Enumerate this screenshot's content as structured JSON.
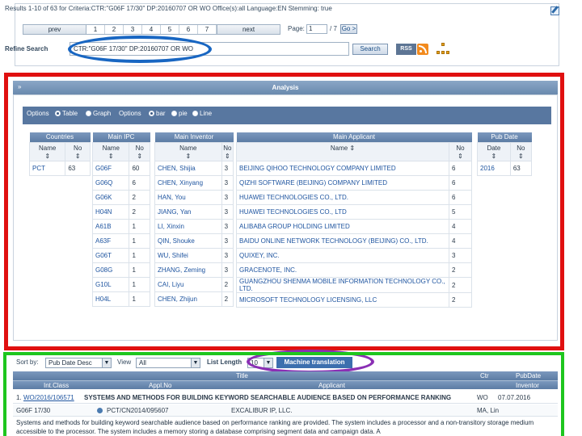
{
  "query": {
    "results_text": "Results 1-10 of 63 for Criteria:CTR:\"G06F 17/30\" DP:20160707 OR WO Office(s):all Language:EN Stemming: true",
    "pager": {
      "prev_label": "prev",
      "pages": [
        "1",
        "2",
        "3",
        "4",
        "5",
        "6",
        "7"
      ],
      "next_label": "next",
      "page_label": "Page:",
      "page_value": "1",
      "page_total": "/ 7",
      "go_label": "Go >"
    },
    "refine_label": "Refine Search",
    "refine_value": "CTR:\"G06F 17/30\" DP:20160707 OR WO",
    "search_label": "Search",
    "rss_label": "RSS"
  },
  "analysis": {
    "title": "Analysis",
    "options1_label": "Options",
    "table_label": "Table",
    "graph_label": "Graph",
    "options2_label": "Options",
    "bar_label": "bar",
    "pie_label": "pie",
    "line_label": "Line",
    "countries": {
      "header": "Countries",
      "col_name": "Name",
      "col_no": "No",
      "rows": [
        {
          "name": "PCT",
          "no": "63"
        }
      ]
    },
    "ipc": {
      "header": "Main IPC",
      "col_name": "Name",
      "col_no": "No",
      "rows": [
        {
          "name": "G06F",
          "no": "60"
        },
        {
          "name": "G06Q",
          "no": "6"
        },
        {
          "name": "G06K",
          "no": "2"
        },
        {
          "name": "H04N",
          "no": "2"
        },
        {
          "name": "A61B",
          "no": "1"
        },
        {
          "name": "A63F",
          "no": "1"
        },
        {
          "name": "G06T",
          "no": "1"
        },
        {
          "name": "G08G",
          "no": "1"
        },
        {
          "name": "G10L",
          "no": "1"
        },
        {
          "name": "H04L",
          "no": "1"
        }
      ]
    },
    "inventor": {
      "header": "Main Inventor",
      "col_name": "Name",
      "col_no": "No",
      "rows": [
        {
          "name": "CHEN, Shijia",
          "no": "3"
        },
        {
          "name": "CHEN, Xinyang",
          "no": "3"
        },
        {
          "name": "HAN, You",
          "no": "3"
        },
        {
          "name": "JIANG, Yan",
          "no": "3"
        },
        {
          "name": "LI, Xinxin",
          "no": "3"
        },
        {
          "name": "QIN, Shouke",
          "no": "3"
        },
        {
          "name": "WU, Shifei",
          "no": "3"
        },
        {
          "name": "ZHANG, Zeming",
          "no": "3"
        },
        {
          "name": "CAI, Liyu",
          "no": "2"
        },
        {
          "name": "CHEN, Zhijun",
          "no": "2"
        }
      ]
    },
    "applicant": {
      "header": "Main Applicant",
      "col_name": "Name",
      "col_no": "No",
      "rows": [
        {
          "name": "BEIJING QIHOO TECHNOLOGY COMPANY LIMITED",
          "no": "6"
        },
        {
          "name": "QIZHI SOFTWARE (BEIJING) COMPANY LIMITED",
          "no": "6"
        },
        {
          "name": "HUAWEI TECHNOLOGIES CO., LTD.",
          "no": "6"
        },
        {
          "name": "HUAWEI TECHNOLOGIES CO., LTD",
          "no": "5"
        },
        {
          "name": "ALIBABA GROUP HOLDING LIMITED",
          "no": "4"
        },
        {
          "name": "BAIDU ONLINE NETWORK TECHNOLOGY (BEIJING) CO., LTD.",
          "no": "4"
        },
        {
          "name": "QUIXEY, INC.",
          "no": "3"
        },
        {
          "name": "GRACENOTE, INC.",
          "no": "2"
        },
        {
          "name": "GUANGZHOU SHENMA MOBILE INFORMATION TECHNOLOGY CO., LTD.",
          "no": "2"
        },
        {
          "name": "MICROSOFT TECHNOLOGY LICENSING, LLC",
          "no": "2"
        }
      ]
    },
    "pubdate": {
      "header": "Pub Date",
      "col_date": "Date",
      "col_no": "No",
      "rows": [
        {
          "date": "2016",
          "no": "63"
        }
      ]
    }
  },
  "results": {
    "sort_label": "Sort by:",
    "sort_value": "Pub Date Desc",
    "view_label": "View",
    "view_value": "All",
    "list_length_label": "List Length",
    "list_length_value": "10",
    "machine_translation_label": "Machine translation",
    "head_title": "Title",
    "head_ctr": "Ctr",
    "head_pubdate": "PubDate",
    "head_intclass": "Int.Class",
    "head_applno": "Appl.No",
    "head_applicant": "Applicant",
    "head_inventor": "Inventor",
    "item": {
      "num": "1.",
      "id": "WO/2016/106571",
      "title": "SYSTEMS AND METHODS FOR BUILDING KEYWORD SEARCHABLE AUDIENCE BASED ON PERFORMANCE RANKING",
      "ctr": "WO",
      "pubdate": "07.07.2016",
      "intclass": "G06F 17/30",
      "applno": "PCT/CN2014/095607",
      "applicant": "EXCALIBUR IP, LLC.",
      "inventor": "MA, Lin",
      "abstract": "Systems and methods for building keyword searchable audience based on performance ranking are provided. The system includes a processor and a non-transitory storage medium accessible to the processor. The system includes a memory storing a database comprising segment data and campaign data. A"
    }
  },
  "colors": {
    "red_highlight": "#e01010",
    "green_highlight": "#1ec61e",
    "blue_highlight": "#1866c2",
    "purple_highlight": "#8a2fb4",
    "header_blue": "#5c7ca4"
  }
}
